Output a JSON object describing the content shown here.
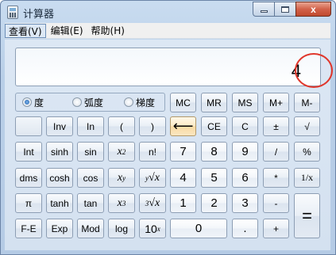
{
  "window": {
    "title": "计算器",
    "minimize": "–",
    "maximize": "□",
    "close": "x"
  },
  "menu": [
    {
      "label": "查看(V)"
    },
    {
      "label": "编辑(E)"
    },
    {
      "label": "帮助(H)"
    }
  ],
  "display": {
    "value": "4"
  },
  "angle_modes": [
    {
      "label": "度",
      "selected": true
    },
    {
      "label": "弧度",
      "selected": false
    },
    {
      "label": "梯度",
      "selected": false
    }
  ],
  "memory": [
    "MC",
    "MR",
    "MS",
    "M+",
    "M-"
  ],
  "keys": {
    "inv": "Inv",
    "ln": "In",
    "lparen": "(",
    "rparen": ")",
    "backspace": "⟵",
    "ce": "CE",
    "c": "C",
    "plusminus": "±",
    "sqrt": "√",
    "int": "Int",
    "sinh": "sinh",
    "sin": "sin",
    "x2": "x",
    "x2_sup": "2",
    "fact": "n!",
    "n7": "7",
    "n8": "8",
    "n9": "9",
    "div": "/",
    "pct": "%",
    "dms": "dms",
    "cosh": "cosh",
    "cos": "cos",
    "xy": "x",
    "xy_sup": "y",
    "yroot": "∜x",
    "yroot_pre": "y",
    "yroot_x": "x",
    "n4": "4",
    "n5": "5",
    "n6": "6",
    "mul": "*",
    "recip": "1/x",
    "pi": "π",
    "tanh": "tanh",
    "tan": "tan",
    "x3": "x",
    "x3_sup": "3",
    "croot_pre": "3",
    "croot_x": "x",
    "n1": "1",
    "n2": "2",
    "n3": "3",
    "sub": "-",
    "eq": "=",
    "fe": "F-E",
    "exp": "Exp",
    "mod": "Mod",
    "log": "log",
    "tenx": "10",
    "tenx_sup": "x",
    "n0": "0",
    "dot": ".",
    "add": "+"
  }
}
